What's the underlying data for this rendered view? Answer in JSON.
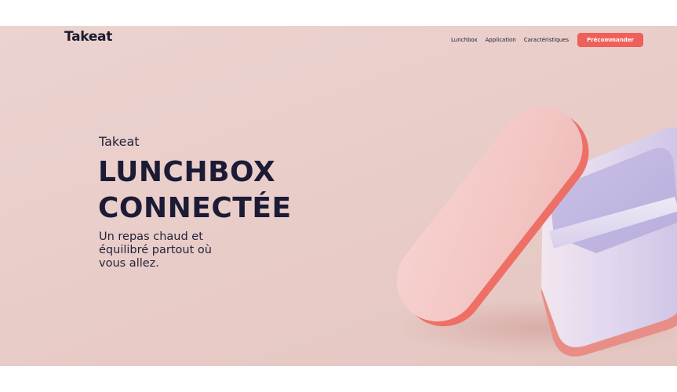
{
  "header": {
    "logo": "Takeat",
    "nav": [
      "Lunchbox",
      "Application",
      "Caractéristiques"
    ],
    "cta_label": "Précommander"
  },
  "hero": {
    "eyebrow": "Takeat",
    "title_lines": [
      "LUNCHBOX",
      "CONNECTÉE"
    ],
    "subtitle": "Un repas chaud et équilibré partout où vous allez."
  },
  "colors": {
    "hero_background": "#e9cdc9",
    "accent": "#f0605a",
    "text_dark": "#1c1b35",
    "lid_pink": "#f4cbc9",
    "box_lilac": "#d9d0ea"
  },
  "image": {
    "subject": "lunchbox-illustration"
  }
}
